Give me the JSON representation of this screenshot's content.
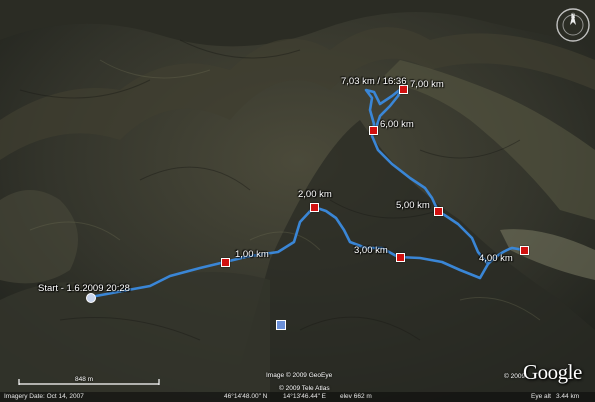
{
  "map": {
    "track_color": "#3a86d6",
    "marker_color": "#d01010",
    "labels": {
      "start": "Start - 1.6.2009 20:28",
      "km1": "1,00 km",
      "km2": "2,00 km",
      "km3": "3,00 km",
      "km4": "4,00 km",
      "km5": "5,00 km",
      "km6": "6,00 km",
      "km7": "7,00 km",
      "end": "7,03 km / 16:36"
    }
  },
  "credits": {
    "line1": "Image © 2009 GeoEye",
    "line2": "© 2009 Tele Atlas",
    "logo": "Google",
    "logo_year": "© 2009"
  },
  "scale": {
    "label": "848 m"
  },
  "status": {
    "imagery_date": "Imagery Date: Oct 14, 2007",
    "lat": "46°14'48.00\" N",
    "lon": "14°13'46.44\" E",
    "elev": "elev  662 m",
    "eye_alt_label": "Eye alt",
    "eye_alt_value": "3.44 km"
  },
  "icons": [
    "compass-icon",
    "photo-pin-icon",
    "start-pin-icon"
  ]
}
